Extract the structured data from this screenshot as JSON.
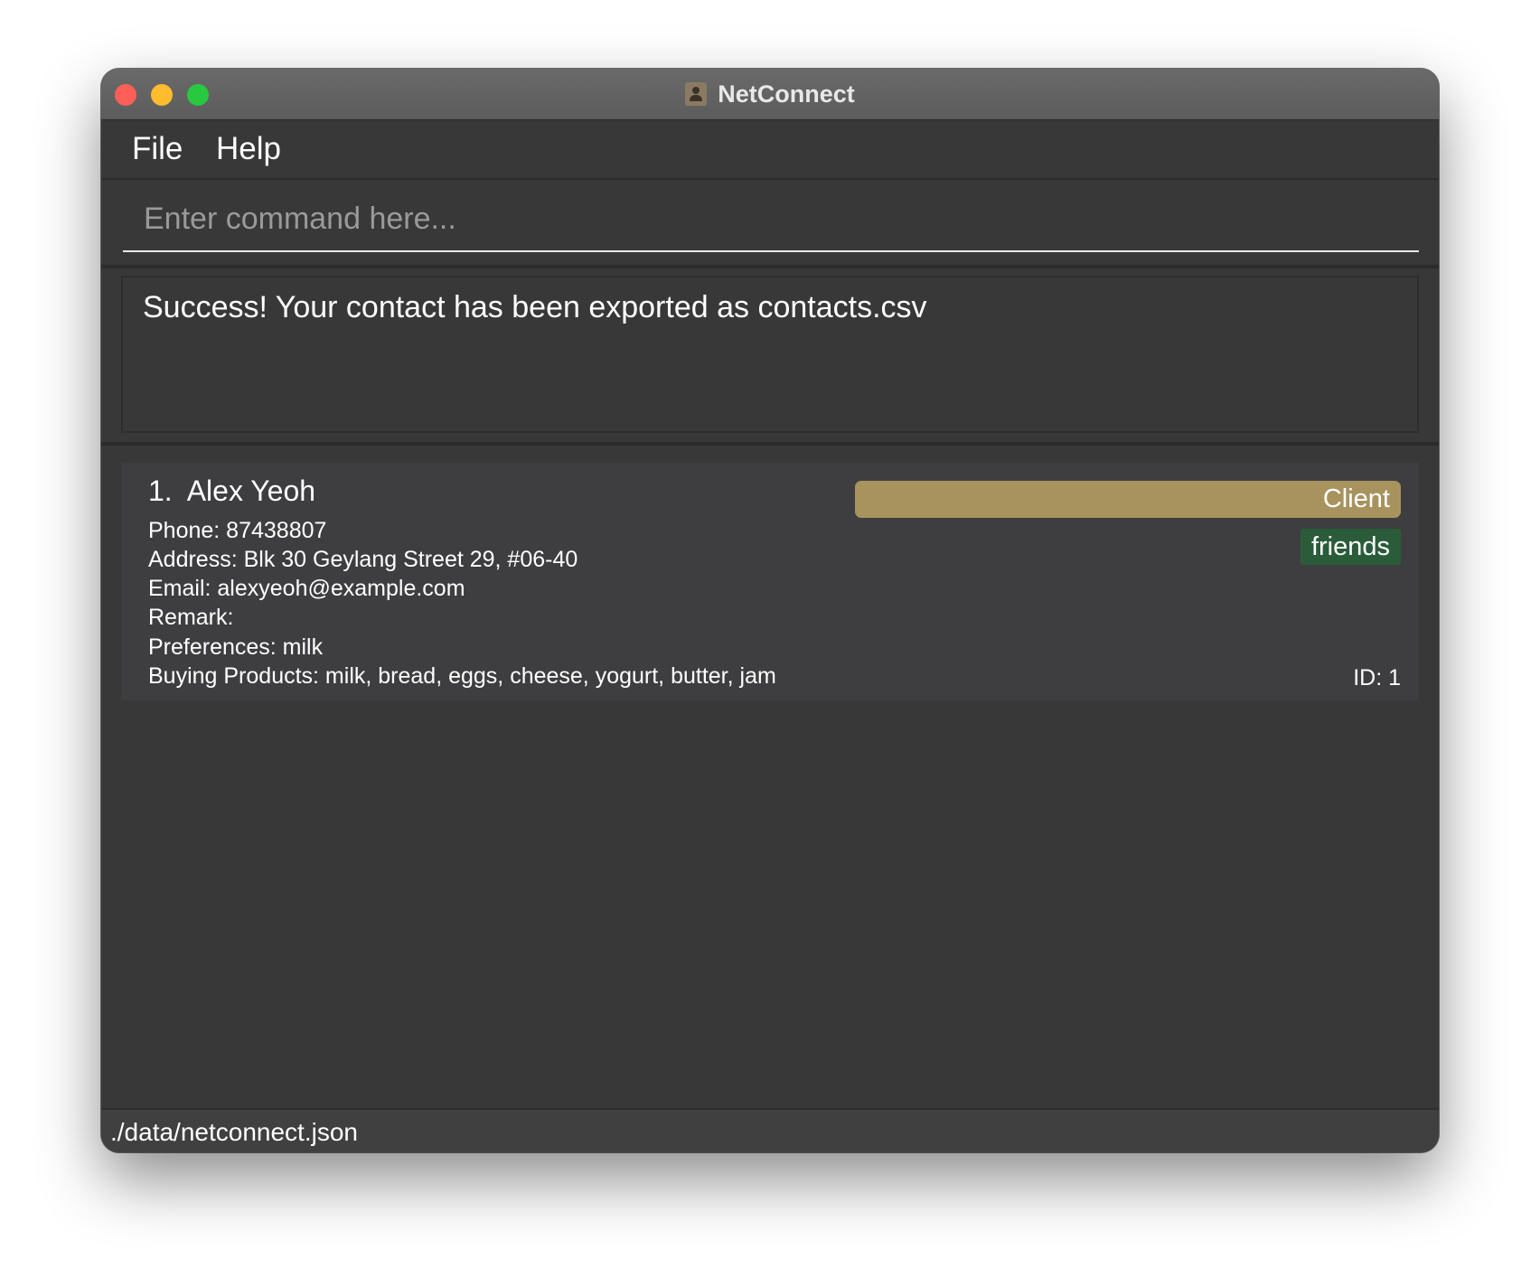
{
  "window": {
    "title": "NetConnect",
    "icon": "contacts-app-icon"
  },
  "menu": {
    "file": "File",
    "help": "Help"
  },
  "command": {
    "placeholder": "Enter command here...",
    "value": ""
  },
  "result": {
    "message": "Success! Your contact has been exported as contacts.csv"
  },
  "contacts": [
    {
      "index": "1.",
      "name": "Alex Yeoh",
      "phone": "Phone: 87438807",
      "address": "Address: Blk 30 Geylang Street 29, #06-40",
      "email": "Email: alexyeoh@example.com",
      "remark": "Remark:",
      "preferences": "Preferences: milk",
      "products": "Buying Products: milk, bread, eggs, cheese, yogurt, butter, jam",
      "role": "Client",
      "tags": [
        "friends"
      ],
      "id": "ID: 1"
    }
  ],
  "status": {
    "path": "./data/netconnect.json"
  },
  "colors": {
    "window_bg": "#383838",
    "card_bg": "#3e3e40",
    "client_tag": "#a8935f",
    "friends_tag": "#2a5c3a"
  }
}
